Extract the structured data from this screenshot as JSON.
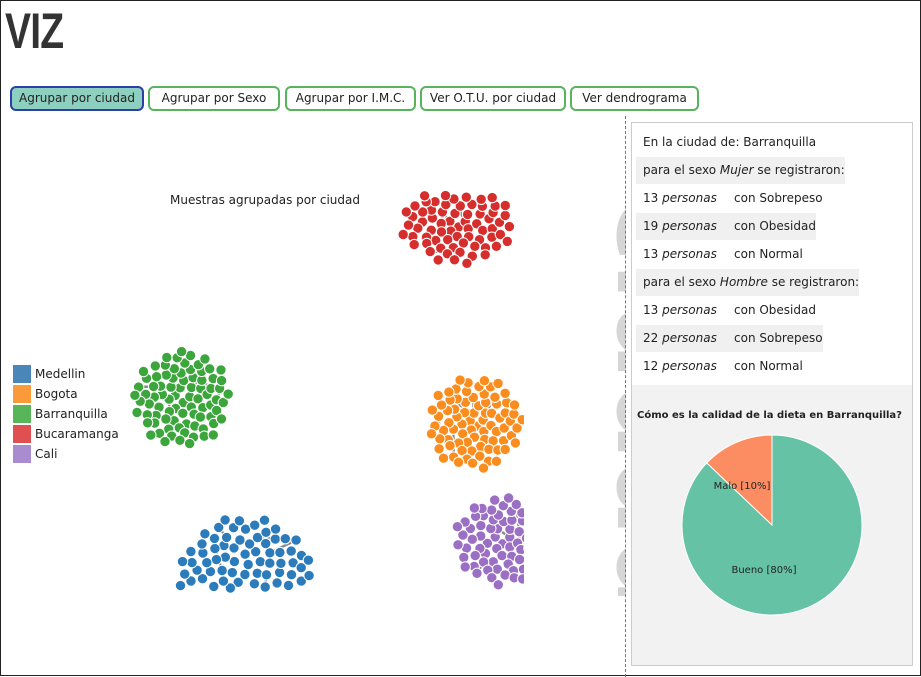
{
  "app": {
    "title": "VIZ"
  },
  "buttons": [
    {
      "label": "Agrupar por ciudad",
      "active": true
    },
    {
      "label": "Agrupar por Sexo",
      "active": false
    },
    {
      "label": "Agrupar por I.M.C.",
      "active": false
    },
    {
      "label": "Ver O.T.U. por ciudad",
      "active": false
    },
    {
      "label": "Ver dendrograma",
      "active": false
    }
  ],
  "chart": {
    "caption": "Muestras agrupadas por ciudad",
    "watermark": "ciudad",
    "clusters": [
      {
        "city": "Barranquilla",
        "color": "#3ca63c",
        "count": 84
      },
      {
        "city": "Bucaramanga",
        "color": "#d62d2d",
        "count": 70
      },
      {
        "city": "Bogota",
        "color": "#fb8c1e",
        "count": 80
      },
      {
        "city": "Medellin",
        "color": "#2c7bbb",
        "count": 95
      },
      {
        "city": "Cali",
        "color": "#9b6fc4",
        "count": 70
      }
    ]
  },
  "legend": [
    {
      "label": "Medellin",
      "color": "#4a86b8"
    },
    {
      "label": "Bogota",
      "color": "#fb9a3a"
    },
    {
      "label": "Barranquilla",
      "color": "#59b559"
    },
    {
      "label": "Bucaramanga",
      "color": "#e05050"
    },
    {
      "label": "Cali",
      "color": "#a98bcf"
    }
  ],
  "panel": {
    "city_line": "En la ciudad de: Barranquilla",
    "mujer_header": {
      "pre": "para el sexo ",
      "sex": "Mujer",
      "post": " se registraron:"
    },
    "mujer_rows": [
      {
        "n": "13",
        "unit": "personas",
        "desc": "con Sobrepeso"
      },
      {
        "n": "19",
        "unit": "personas",
        "desc": "con Obesidad"
      },
      {
        "n": "13",
        "unit": "personas",
        "desc": "con Normal"
      }
    ],
    "hombre_header": {
      "pre": "para el sexo ",
      "sex": "Hombre",
      "post": " se registraron:"
    },
    "hombre_rows": [
      {
        "n": "13",
        "unit": "personas",
        "desc": "con Obesidad"
      },
      {
        "n": "22",
        "unit": "personas",
        "desc": "con Sobrepeso"
      },
      {
        "n": "12",
        "unit": "personas",
        "desc": "con Normal"
      }
    ],
    "pie_title": "Cómo es la calidad de la dieta en Barranquilla?",
    "pie_slices": [
      {
        "label": "Bueno [80%]",
        "value": 80,
        "color": "#66c2a5"
      },
      {
        "label": "Malo [10%]",
        "value": 10,
        "color": "#fc8d62"
      }
    ]
  }
}
